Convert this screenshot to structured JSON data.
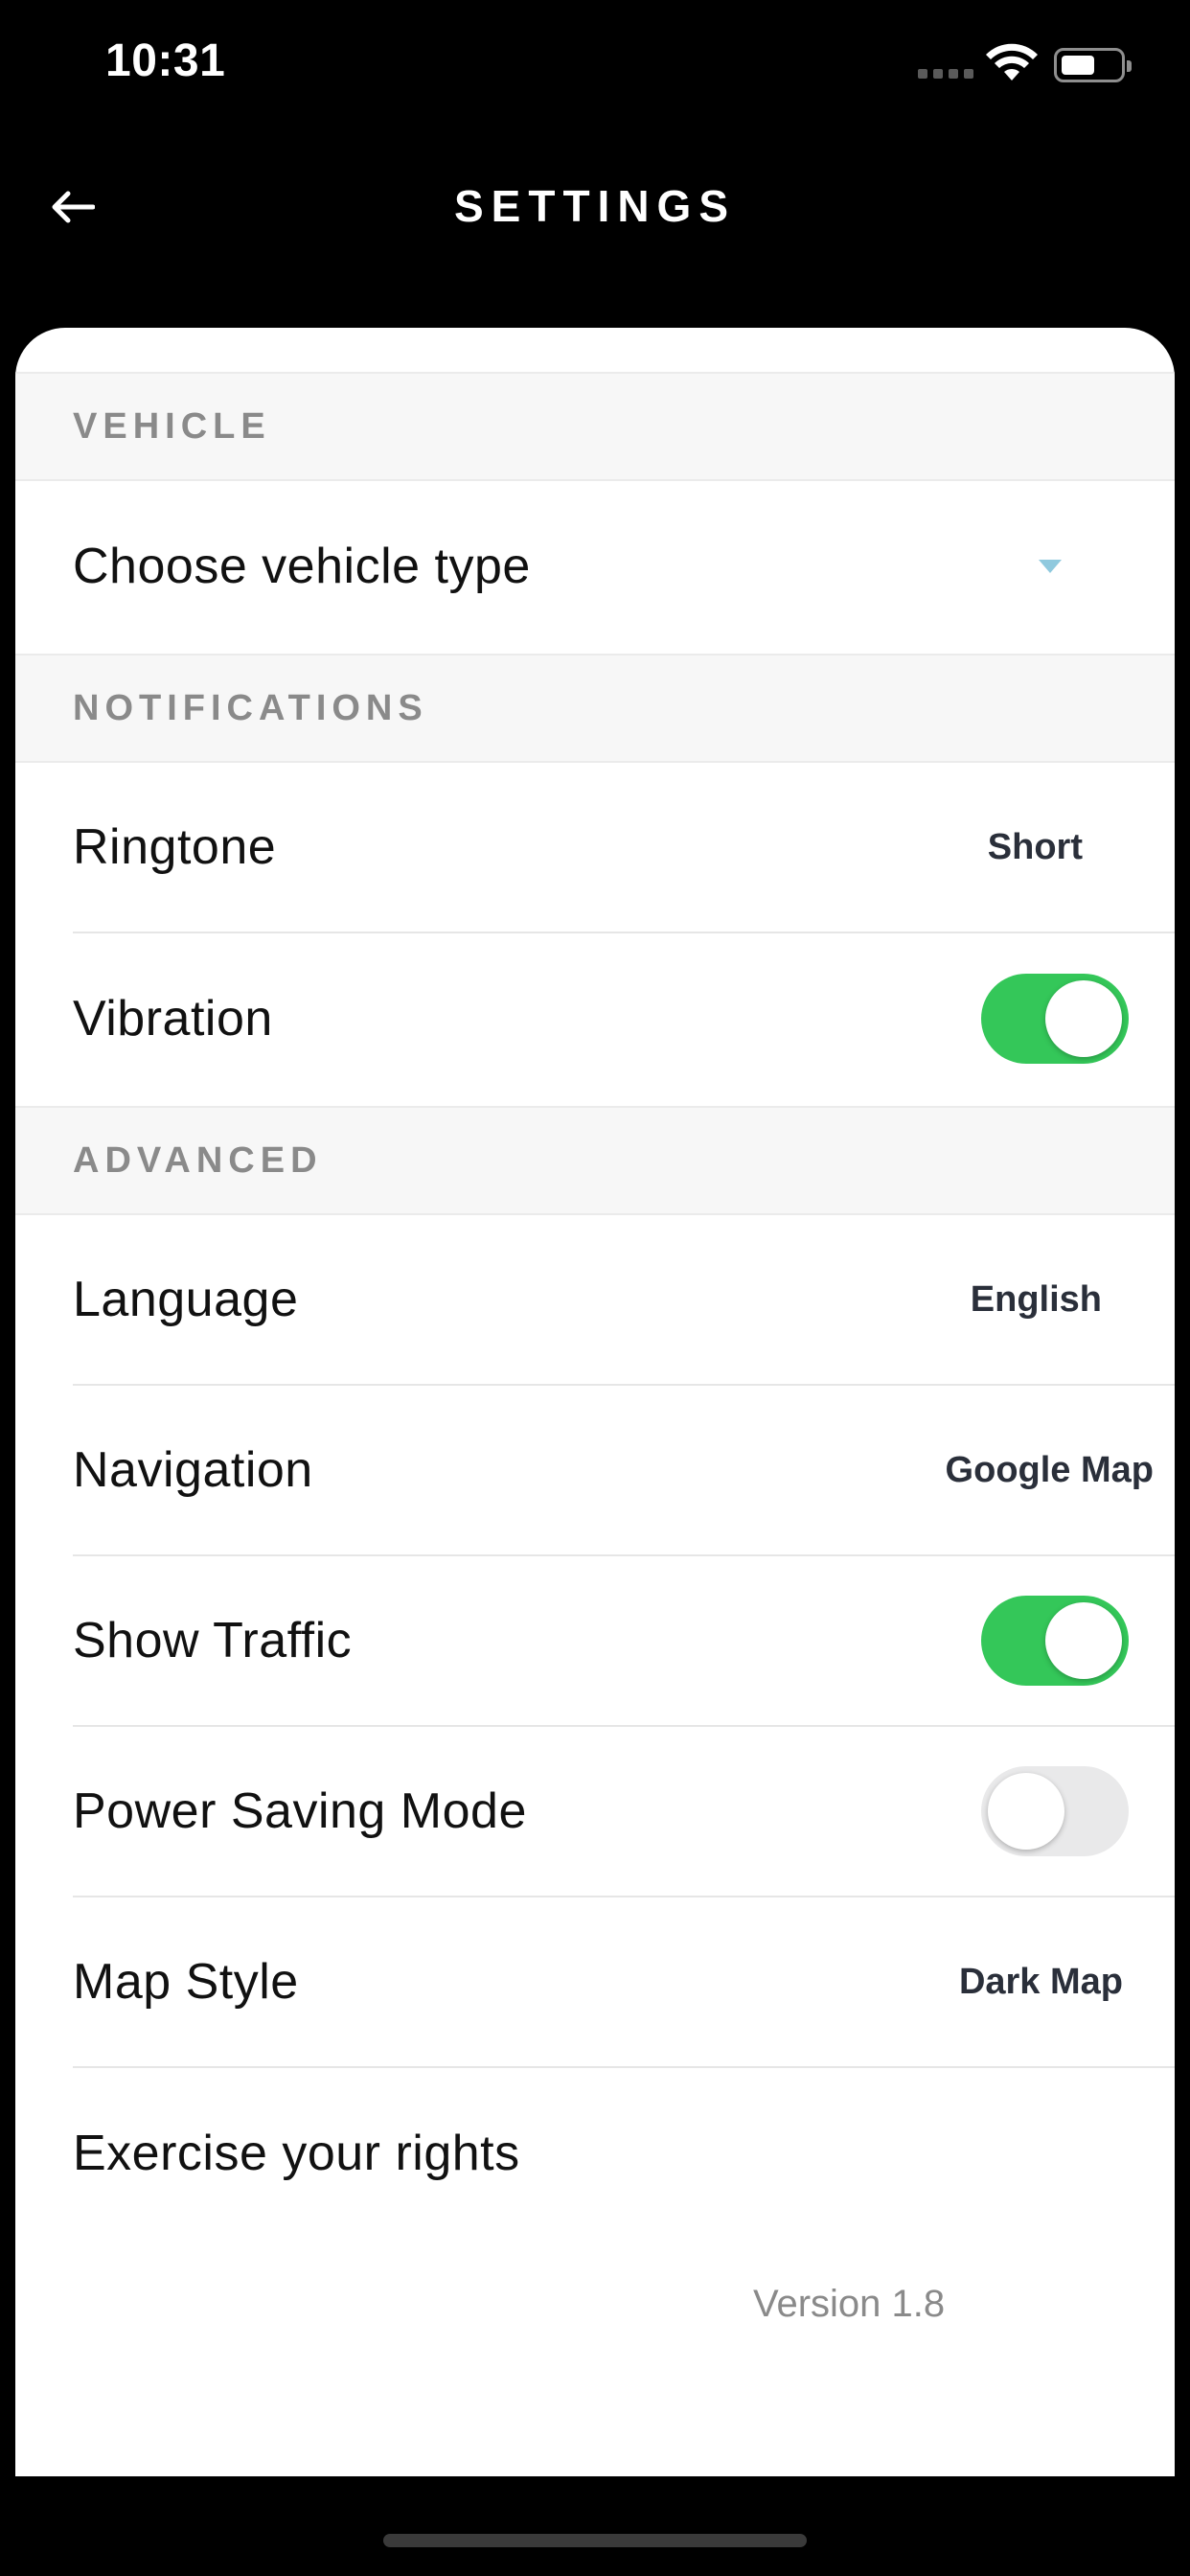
{
  "status_bar": {
    "time": "10:31"
  },
  "header": {
    "title": "SETTINGS"
  },
  "sections": {
    "vehicle": {
      "title": "VEHICLE",
      "choose_vehicle": "Choose vehicle type"
    },
    "notifications": {
      "title": "NOTIFICATIONS",
      "ringtone": {
        "label": "Ringtone",
        "value": "Short"
      },
      "vibration": {
        "label": "Vibration",
        "enabled": true
      }
    },
    "advanced": {
      "title": "ADVANCED",
      "language": {
        "label": "Language",
        "value": "English"
      },
      "navigation": {
        "label": "Navigation",
        "value": "Google Map"
      },
      "show_traffic": {
        "label": "Show Traffic",
        "enabled": true
      },
      "power_saving": {
        "label": "Power Saving Mode",
        "enabled": false
      },
      "map_style": {
        "label": "Map Style",
        "value": "Dark Map"
      },
      "rights": {
        "label": "Exercise your rights"
      }
    }
  },
  "footer": {
    "version": "Version 1.8"
  },
  "colors": {
    "toggle_on": "#34c759",
    "toggle_off": "#e9e9ea",
    "dropdown_arrow": "#8fc9de"
  }
}
